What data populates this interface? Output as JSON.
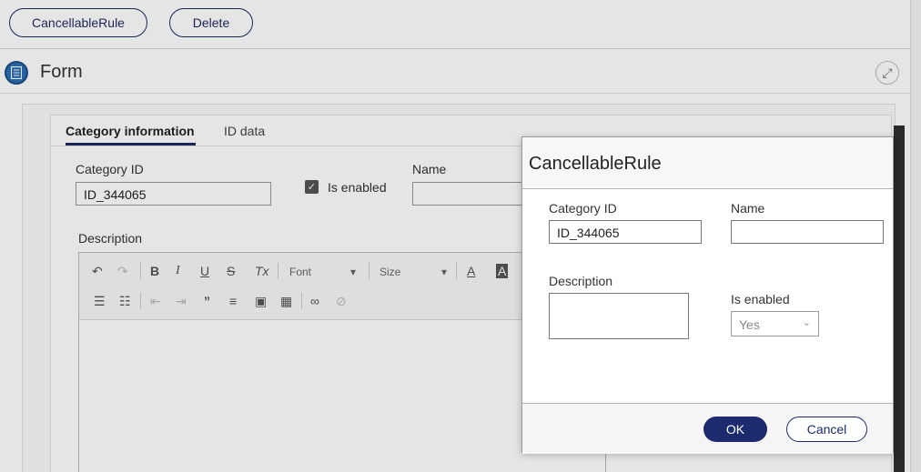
{
  "toolbar": {
    "cancellable_label": "CancellableRule",
    "delete_label": "Delete"
  },
  "form": {
    "title": "Form",
    "tabs": [
      {
        "label": "Category information"
      },
      {
        "label": "ID data"
      }
    ],
    "category_id_label": "Category ID",
    "category_id_value": "ID_344065",
    "is_enabled_label": "Is enabled",
    "name_label": "Name",
    "description_label": "Description"
  },
  "editor": {
    "font_label": "Font",
    "size_label": "Size"
  },
  "modal": {
    "title": "CancellableRule",
    "category_id_label": "Category ID",
    "category_id_value": "ID_344065",
    "name_label": "Name",
    "name_value": "",
    "description_label": "Description",
    "description_value": "",
    "is_enabled_label": "Is enabled",
    "is_enabled_value": "Yes",
    "ok_label": "OK",
    "cancel_label": "Cancel"
  },
  "colors": {
    "brand_navy": "#1e2a6e",
    "form_icon_blue": "#2a6fb6"
  },
  "icons": [
    "document-icon",
    "expand-icon",
    "check-icon",
    "chevron-down-icon"
  ]
}
